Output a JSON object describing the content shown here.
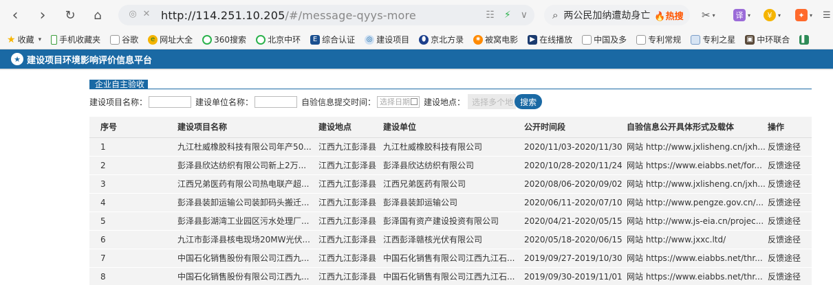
{
  "browser": {
    "url_host": "http://114.251.10.205",
    "url_path": "/#/message-qyys-more",
    "search_query": "两公民加纳遭劫身亡",
    "search_badge": "热搜",
    "ext_labels": [
      "译",
      "¥"
    ]
  },
  "bookmarks": [
    {
      "label": "收藏",
      "icon": "star-icon"
    },
    {
      "label": "手机收藏夹",
      "icon": "phone-icon"
    },
    {
      "label": "谷歌",
      "icon": "page-icon"
    },
    {
      "label": "网址大全",
      "icon": "globe-icon"
    },
    {
      "label": "360搜索",
      "icon": "search-360-icon"
    },
    {
      "label": "北京中环",
      "icon": "search-360-icon"
    },
    {
      "label": "综合认证",
      "icon": "app-icon"
    },
    {
      "label": "建设项目",
      "icon": "globe-icon"
    },
    {
      "label": "京北方录",
      "icon": "bank-icon"
    },
    {
      "label": "被窝电影",
      "icon": "film-icon"
    },
    {
      "label": "在线播放",
      "icon": "play-icon"
    },
    {
      "label": "中国及多",
      "icon": "page-icon"
    },
    {
      "label": "专利常规",
      "icon": "page-icon"
    },
    {
      "label": "专利之星",
      "icon": "doc-icon"
    },
    {
      "label": "中环联合",
      "icon": "image-icon"
    }
  ],
  "site": {
    "title": "建设项目环境影响评价信息平台"
  },
  "section": {
    "tab_label": "企业自主验收"
  },
  "filters": {
    "project_name_label": "建设项目名称：",
    "unit_name_label": "建设单位名称：",
    "submit_time_label": "自验信息提交时间：",
    "date_placeholder": "选择日期",
    "location_label": "建设地点：",
    "location_placeholder": "选择多个地",
    "search_button": "搜索"
  },
  "table": {
    "headers": [
      "序号",
      "建设项目名称",
      "建设地点",
      "建设单位",
      "公开时间段",
      "自验信息公开具体形式及载体",
      "操作"
    ],
    "rows": [
      [
        "1",
        "九江杜威橡胶科技有限公司年产50...",
        "江西九江彭泽县",
        "九江杜威橡胶科技有限公司",
        "2020/11/03-2020/11/30",
        "网站 http://www.jxlisheng.cn/jxh...",
        "反馈途径"
      ],
      [
        "2",
        "彭泽县欣达纺织有限公司新上2万...",
        "江西九江彭泽县",
        "彭泽县欣达纺织有限公司",
        "2020/10/28-2020/11/24",
        "网站 https://www.eiabbs.net/for...",
        "反馈途径"
      ],
      [
        "3",
        "江西兄弟医药有限公司热电联产超...",
        "江西九江彭泽县",
        "江西兄弟医药有限公司",
        "2020/08/06-2020/09/02",
        "网站 http://www.jxlisheng.cn/jxh...",
        "反馈途径"
      ],
      [
        "4",
        "彭泽县装卸运输公司装卸码头搬迁...",
        "江西九江彭泽县",
        "彭泽县装卸运输公司",
        "2020/06/11-2020/07/10",
        "网站 http://www.pengze.gov.cn/...",
        "反馈途径"
      ],
      [
        "5",
        "彭泽县彭湖湾工业园区污水处理厂...",
        "江西九江彭泽县",
        "彭泽国有资产建设投资有限公司",
        "2020/04/21-2020/05/15",
        "网站 http://www.js-eia.cn/projec...",
        "反馈途径"
      ],
      [
        "6",
        "九江市彭泽县核电现场20MW光伏...",
        "江西九江彭泽县",
        "江西彭泽赣核光伏有限公司",
        "2020/05/18-2020/06/15",
        "网站 http://www.jxxc.ltd/",
        "反馈途径"
      ],
      [
        "7",
        "中国石化销售股份有限公司江西九...",
        "江西九江彭泽县",
        "中国石化销售有限公司江西九江石...",
        "2019/09/27-2019/10/30",
        "网站 https://www.eiabbs.net/thr...",
        "反馈途径"
      ],
      [
        "8",
        "中国石化销售股份有限公司江西九...",
        "江西九江彭泽县",
        "中国石化销售有限公司江西九江石...",
        "2019/09/30-2019/11/01",
        "网站 https://www.eiabbs.net/thr...",
        "反馈途径"
      ]
    ]
  },
  "colors": {
    "brand": "#1a69a4"
  }
}
